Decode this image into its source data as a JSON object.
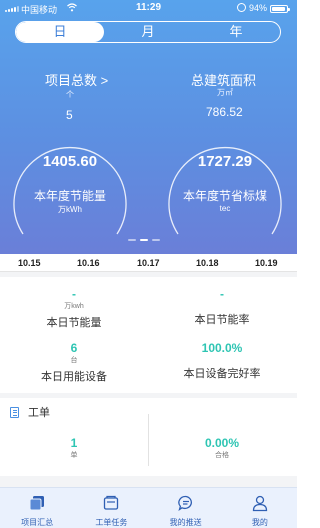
{
  "status_bar": {
    "carrier": "中国移动",
    "time": "11:29",
    "battery": "94%",
    "battery_level": 0.94
  },
  "period_tabs": [
    {
      "label": "日",
      "active": true
    },
    {
      "label": "月",
      "active": false
    },
    {
      "label": "年",
      "active": false
    }
  ],
  "summary": {
    "project_total": {
      "label": "项目总数 >",
      "unit": "个",
      "value": "5"
    },
    "building_area": {
      "label": "总建筑面积",
      "unit": "万㎡",
      "value": "786.52"
    }
  },
  "rings": {
    "energy_saving": {
      "value": "1405.60",
      "label": "本年度节能量",
      "unit": "万kWh"
    },
    "coal_saving": {
      "value": "1727.29",
      "label": "本年度节省标煤",
      "unit": "tec"
    }
  },
  "pager": {
    "count": 3,
    "active_index": 1
  },
  "dates": [
    "10.15",
    "10.16",
    "10.17",
    "10.18",
    "10.19"
  ],
  "daily": {
    "energy_saving": {
      "value": "-",
      "unit": "万kwh",
      "label": "本日节能量"
    },
    "saving_rate": {
      "value": "-",
      "label": "本日节能率"
    },
    "devices": {
      "value": "6",
      "unit": "台",
      "label": "本日用能设备"
    },
    "device_health": {
      "value": "100.0%",
      "label": "本日设备完好率"
    }
  },
  "work_order": {
    "title": "工单",
    "count": {
      "value": "1",
      "label": "单"
    },
    "pass_rate": {
      "value": "0.00%",
      "label": "合格"
    }
  },
  "tabbar": [
    {
      "label": "项目汇总",
      "icon": "summary-icon"
    },
    {
      "label": "工单任务",
      "icon": "task-icon"
    },
    {
      "label": "我的推送",
      "icon": "chat-icon"
    },
    {
      "label": "我的",
      "icon": "user-icon"
    }
  ],
  "colors": {
    "accent": "#4a90e2",
    "teal": "#2ec5b3",
    "tab_text": "#2f5fb3"
  }
}
